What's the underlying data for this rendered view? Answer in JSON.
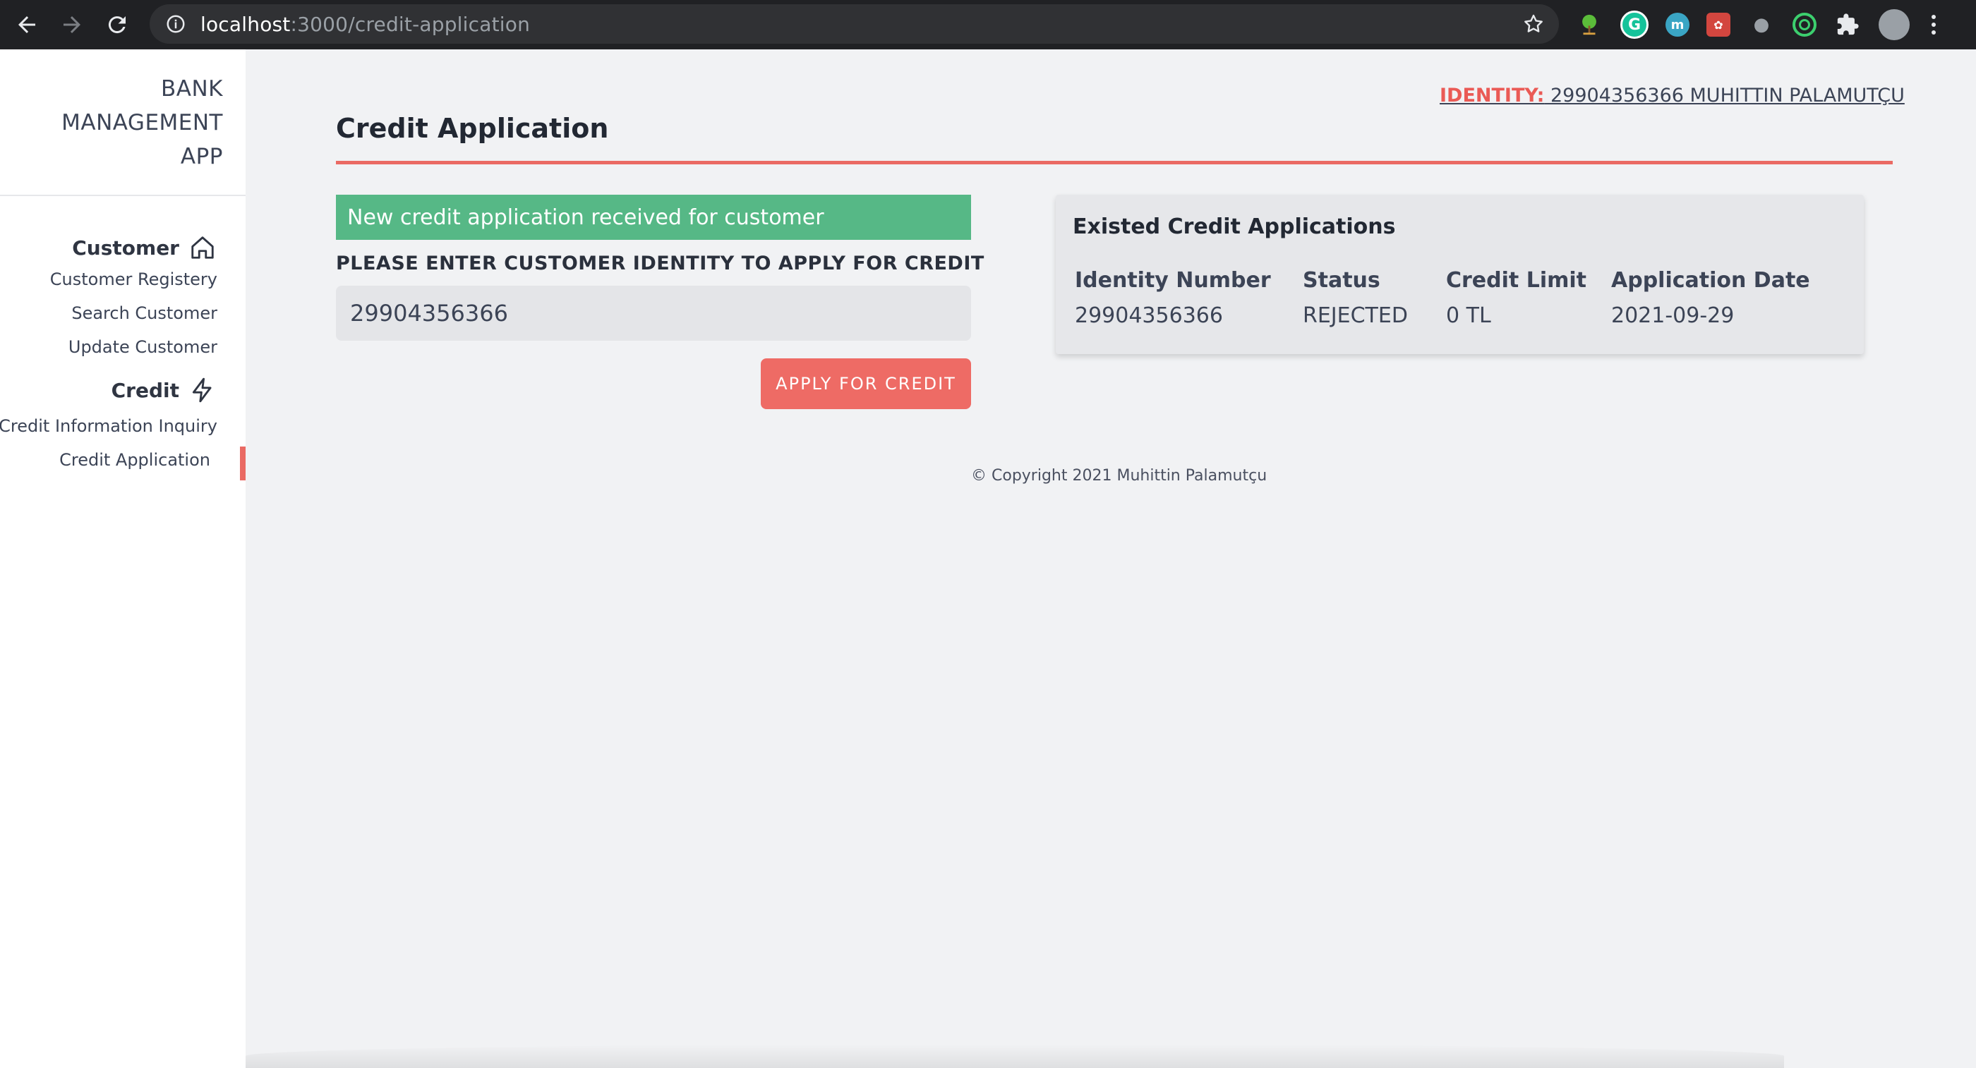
{
  "browser": {
    "url_host": "localhost",
    "url_path": ":3000/credit-application"
  },
  "sidebar": {
    "brand_lines": [
      "BANK",
      "MANAGEMENT",
      "APP"
    ],
    "sections": [
      {
        "label": "Customer",
        "icon": "home-icon",
        "items": [
          "Customer Registery",
          "Search Customer",
          "Update Customer"
        ]
      },
      {
        "label": "Credit",
        "icon": "lightning-icon",
        "items": [
          "Credit Information Inquiry",
          "Credit Application"
        ]
      }
    ],
    "active_item": "Credit Application"
  },
  "header": {
    "identity_label": "IDENTITY:",
    "identity_value": " 29904356366 MUHITTIN PALAMUTÇU",
    "page_title": "Credit Application"
  },
  "form": {
    "alert": "New credit application received for customer",
    "field_label": "PLEASE ENTER CUSTOMER IDENTITY TO APPLY FOR CREDIT",
    "identity_value": "29904356366",
    "button_label": "APPLY FOR CREDIT"
  },
  "applications": {
    "title": "Existed Credit Applications",
    "columns": [
      "Identity Number",
      "Status",
      "Credit Limit",
      "Application Date"
    ],
    "rows": [
      [
        "29904356366",
        "REJECTED",
        "0 TL",
        "2021-09-29"
      ]
    ]
  },
  "footer": "© Copyright 2021 Muhittin Palamutçu",
  "colors": {
    "accent": "#ea6a63",
    "success": "#56b886",
    "sidebar_bg": "#ffffff",
    "page_bg": "#f1f2f4"
  }
}
